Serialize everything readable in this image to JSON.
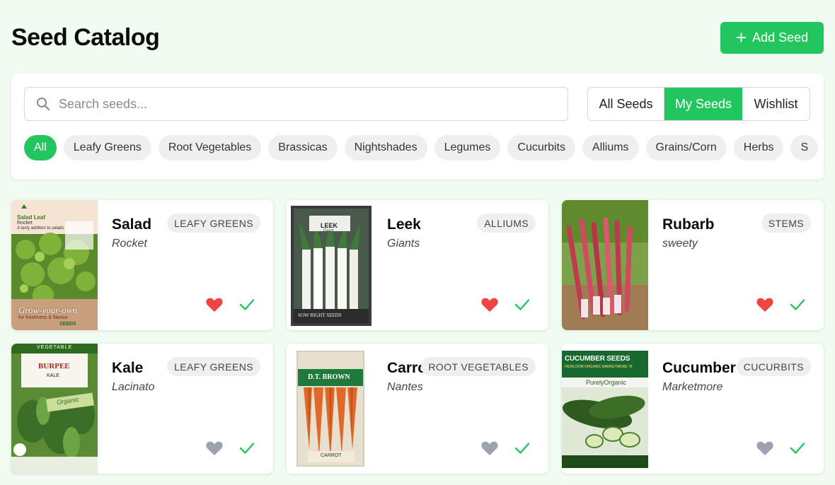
{
  "header": {
    "title": "Seed Catalog",
    "add_button": "Add Seed",
    "add_icon": "plus-icon"
  },
  "search": {
    "placeholder": "Search seeds...",
    "value": ""
  },
  "view_toggle": {
    "options": [
      "All Seeds",
      "My Seeds",
      "Wishlist"
    ],
    "selected": "My Seeds"
  },
  "categories": {
    "items": [
      "All",
      "Leafy Greens",
      "Root Vegetables",
      "Brassicas",
      "Nightshades",
      "Legumes",
      "Cucurbits",
      "Alliums",
      "Grains/Corn",
      "Herbs",
      "S"
    ],
    "selected": "All"
  },
  "colors": {
    "accent": "#22c55e",
    "favorite": "#ef4444",
    "unfavorited": "#9ca3af",
    "owned": "#22c55e"
  },
  "seeds": [
    {
      "name": "Salad",
      "variety": "Rocket",
      "category": "LEAFY GREENS",
      "favorite": true,
      "owned": true,
      "packet": {
        "top": "Salad Leaf",
        "sub": "Rocket",
        "tagline": "A tasty addition to salads",
        "slogan": "Grow-your-own",
        "slogan2": "for freshness & flavour",
        "brand": "SEEDS"
      }
    },
    {
      "name": "Leek",
      "variety": "Giants",
      "category": "ALLIUMS",
      "favorite": true,
      "owned": true,
      "packet": {
        "top": "LEEK",
        "sub": "Giant",
        "brand": "SOW RIGHT SEEDS"
      }
    },
    {
      "name": "Rubarb",
      "variety": "sweety",
      "category": "STEMS",
      "favorite": true,
      "owned": true
    },
    {
      "name": "Kale",
      "variety": "Lacinato",
      "category": "LEAFY GREENS",
      "favorite": false,
      "owned": true,
      "packet": {
        "top": "VEGETABLE",
        "brand": "BURPEE",
        "sub": "KALE",
        "label": "Organic"
      }
    },
    {
      "name": "Carrot",
      "variety": "Nantes",
      "category": "ROOT VEGETABLES",
      "favorite": false,
      "owned": true,
      "packet": {
        "brand": "D.T. BROWN",
        "label": "CARROT"
      }
    },
    {
      "name": "Cucumber",
      "variety": "Marketmore",
      "category": "CUCURBITS",
      "favorite": false,
      "owned": true,
      "packet": {
        "top": "CUCUMBER SEEDS",
        "sub": "HEIRLOOM ORGANIC MARKETMORE 76",
        "brand": "PurelyOrganic"
      }
    }
  ]
}
